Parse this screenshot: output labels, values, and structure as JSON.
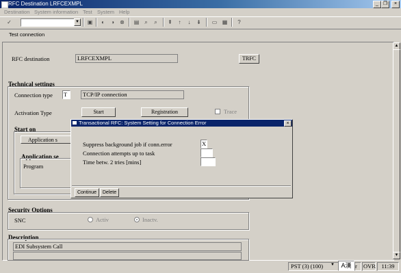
{
  "window": {
    "title": "RFC Destination LRFCEXMPL",
    "min": "_",
    "restore": "❐",
    "close": "×"
  },
  "menubar": [
    "Destination",
    "System information",
    "Test",
    "System",
    "Help"
  ],
  "toolbar": {
    "command_field": "",
    "app_button": "Test connection"
  },
  "main": {
    "rfc_dest_label": "RFC destination",
    "rfc_dest_value": "LRFCEXMPL",
    "trfc_button": "TRFC",
    "tech": {
      "header": "Technical settings",
      "conn_type_label": "Connection type",
      "conn_type_value": "T",
      "conn_type_desc": "TCP/IP connection",
      "activation_label": "Activation Type",
      "start_button": "Start",
      "registration_button": "Registration",
      "trace_label": "Trace",
      "start_on_header": "Start on",
      "app_server_button": "Application s",
      "app_server_header": "Application se",
      "program_label": "Program"
    },
    "security": {
      "header": "Security Options",
      "snc_label": "SNC",
      "activ_label": "Activ",
      "inactv_label": "Inactv."
    },
    "description": {
      "header": "Description",
      "line1": "EDI Subsystem Call",
      "line2": ""
    }
  },
  "dialog": {
    "title": "Transactional RFC: System Setting for Connection Error",
    "close": "×",
    "row1_label": "Suppress background job if conn.error",
    "row1_value": "X",
    "row2_label": "Connection attempts up to task",
    "row2_value": "",
    "row3_label": "Time betw. 2 tries [mins]",
    "row3_value": "",
    "continue_button": "Continue",
    "delete_button": "Delete"
  },
  "statusbar": {
    "system": "PST (3) (100)",
    "ime": "A漢",
    "user": "r",
    "mode": "OVR",
    "time": "11:39"
  }
}
